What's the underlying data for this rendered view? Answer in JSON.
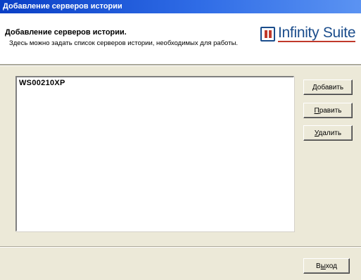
{
  "window": {
    "title": "Добавление серверов истории"
  },
  "header": {
    "title": "Добавление серверов истории.",
    "description": "Здесь можно задать список серверов истории, необходимых для работы.",
    "logo_text": "Infinity Suite"
  },
  "servers": {
    "items": [
      "WS00210XP"
    ]
  },
  "buttons": {
    "add": {
      "underline": "Д",
      "rest": "обавить"
    },
    "edit": {
      "underline": "П",
      "rest": "равить"
    },
    "delete": {
      "underline": "У",
      "rest": "далить"
    },
    "exit": {
      "pre": "В",
      "underline": "ы",
      "rest": "ход"
    }
  },
  "colors": {
    "titlebar": "#2f6ce6",
    "logo_blue": "#1b4d8c",
    "logo_red": "#c0392b",
    "dialog_bg": "#ece9d8"
  },
  "icons": {
    "logo": "infinity-suite-logo-icon"
  }
}
